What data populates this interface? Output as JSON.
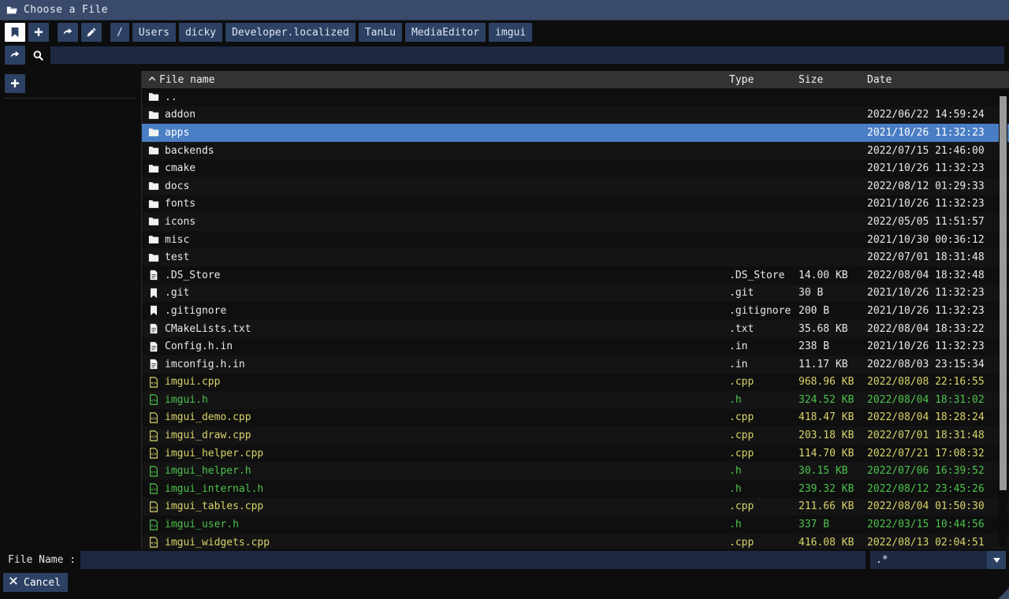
{
  "window": {
    "title": "Choose a File",
    "title_icon": "open-folder-icon"
  },
  "toolbar": {
    "bookmark_icon": "bookmark-icon",
    "add_icon": "plus-icon",
    "share_icon": "share-arrow-icon",
    "edit_icon": "pencil-icon",
    "root_label": "/",
    "breadcrumbs": [
      "Users",
      "dicky",
      "Developer.localized",
      "TanLu",
      "MediaEditor",
      "imgui"
    ]
  },
  "search": {
    "reset_icon": "share-arrow-icon",
    "search_icon": "magnifier-icon",
    "value": "",
    "placeholder": ""
  },
  "sidebar": {
    "add_icon": "plus-icon",
    "bookmarks": []
  },
  "table": {
    "columns": [
      "File name",
      "Type",
      "Size",
      "Date"
    ],
    "sort_indicator": "chevron-up-icon",
    "sort_column": "File name",
    "rows": [
      {
        "icon": "folder-icon",
        "name": "..",
        "type": "",
        "size": "",
        "date": "",
        "color": "#e9e9e9",
        "selected": false
      },
      {
        "icon": "folder-icon",
        "name": "addon",
        "type": "",
        "size": "",
        "date": "2022/06/22 14:59:24",
        "color": "#e9e9e9",
        "selected": false
      },
      {
        "icon": "folder-icon",
        "name": "apps",
        "type": "",
        "size": "",
        "date": "2021/10/26 11:32:23",
        "color": "#ffffff",
        "selected": true
      },
      {
        "icon": "folder-icon",
        "name": "backends",
        "type": "",
        "size": "",
        "date": "2022/07/15 21:46:00",
        "color": "#e9e9e9",
        "selected": false
      },
      {
        "icon": "folder-icon",
        "name": "cmake",
        "type": "",
        "size": "",
        "date": "2021/10/26 11:32:23",
        "color": "#e9e9e9",
        "selected": false
      },
      {
        "icon": "folder-icon",
        "name": "docs",
        "type": "",
        "size": "",
        "date": "2022/08/12 01:29:33",
        "color": "#e9e9e9",
        "selected": false
      },
      {
        "icon": "folder-icon",
        "name": "fonts",
        "type": "",
        "size": "",
        "date": "2021/10/26 11:32:23",
        "color": "#e9e9e9",
        "selected": false
      },
      {
        "icon": "folder-icon",
        "name": "icons",
        "type": "",
        "size": "",
        "date": "2022/05/05 11:51:57",
        "color": "#e9e9e9",
        "selected": false
      },
      {
        "icon": "folder-icon",
        "name": "misc",
        "type": "",
        "size": "",
        "date": "2021/10/30 00:36:12",
        "color": "#e9e9e9",
        "selected": false
      },
      {
        "icon": "folder-icon",
        "name": "test",
        "type": "",
        "size": "",
        "date": "2022/07/01 18:31:48",
        "color": "#e9e9e9",
        "selected": false
      },
      {
        "icon": "document-icon",
        "name": ".DS_Store",
        "type": ".DS_Store",
        "size": "14.00 KB",
        "date": "2022/08/04 18:32:48",
        "color": "#e9e9e9",
        "selected": false
      },
      {
        "icon": "bookmark-icon",
        "name": ".git",
        "type": ".git",
        "size": "30 B",
        "date": "2021/10/26 11:32:23",
        "color": "#e9e9e9",
        "selected": false
      },
      {
        "icon": "bookmark-icon",
        "name": ".gitignore",
        "type": ".gitignore",
        "size": "200 B",
        "date": "2021/10/26 11:32:23",
        "color": "#e9e9e9",
        "selected": false
      },
      {
        "icon": "document-icon",
        "name": "CMakeLists.txt",
        "type": ".txt",
        "size": "35.68 KB",
        "date": "2022/08/04 18:33:22",
        "color": "#e9e9e9",
        "selected": false
      },
      {
        "icon": "document-icon",
        "name": "Config.h.in",
        "type": ".in",
        "size": "238 B",
        "date": "2021/10/26 11:32:23",
        "color": "#e9e9e9",
        "selected": false
      },
      {
        "icon": "document-icon",
        "name": "imconfig.h.in",
        "type": ".in",
        "size": "11.17 KB",
        "date": "2022/08/03 23:15:34",
        "color": "#e9e9e9",
        "selected": false
      },
      {
        "icon": "code-file-icon",
        "name": "imgui.cpp",
        "type": ".cpp",
        "size": "968.96 KB",
        "date": "2022/08/08 22:16:55",
        "color": "#d9d36a",
        "selected": false
      },
      {
        "icon": "code-file-icon",
        "name": "imgui.h",
        "type": ".h",
        "size": "324.52 KB",
        "date": "2022/08/04 18:31:02",
        "color": "#4cc24c",
        "selected": false
      },
      {
        "icon": "code-file-icon",
        "name": "imgui_demo.cpp",
        "type": ".cpp",
        "size": "418.47 KB",
        "date": "2022/08/04 18:28:24",
        "color": "#d9d36a",
        "selected": false
      },
      {
        "icon": "code-file-icon",
        "name": "imgui_draw.cpp",
        "type": ".cpp",
        "size": "203.18 KB",
        "date": "2022/07/01 18:31:48",
        "color": "#d9d36a",
        "selected": false
      },
      {
        "icon": "code-file-icon",
        "name": "imgui_helper.cpp",
        "type": ".cpp",
        "size": "114.70 KB",
        "date": "2022/07/21 17:08:32",
        "color": "#d9d36a",
        "selected": false
      },
      {
        "icon": "code-file-icon",
        "name": "imgui_helper.h",
        "type": ".h",
        "size": "30.15 KB",
        "date": "2022/07/06 16:39:52",
        "color": "#4cc24c",
        "selected": false
      },
      {
        "icon": "code-file-icon",
        "name": "imgui_internal.h",
        "type": ".h",
        "size": "239.32 KB",
        "date": "2022/08/12 23:45:26",
        "color": "#4cc24c",
        "selected": false
      },
      {
        "icon": "code-file-icon",
        "name": "imgui_tables.cpp",
        "type": ".cpp",
        "size": "211.66 KB",
        "date": "2022/08/04 01:50:30",
        "color": "#d9d36a",
        "selected": false
      },
      {
        "icon": "code-file-icon",
        "name": "imgui_user.h",
        "type": ".h",
        "size": "337 B",
        "date": "2022/03/15 10:44:56",
        "color": "#4cc24c",
        "selected": false
      },
      {
        "icon": "code-file-icon",
        "name": "imgui_widgets.cpp",
        "type": ".cpp",
        "size": "416.08 KB",
        "date": "2022/08/13 02:04:51",
        "color": "#d9d36a",
        "selected": false
      }
    ]
  },
  "footer": {
    "filename_label": "File Name :",
    "filename_value": "",
    "filename_placeholder": "",
    "filter_value": ".*",
    "filter_caret_icon": "caret-down-icon",
    "cancel_label": "Cancel",
    "cancel_icon": "close-icon"
  },
  "colors": {
    "accent": "#2c4164",
    "selection": "#4a7ec4",
    "titlebar": "#3a4a6b",
    "cpp": "#d9d36a",
    "header": "#4cc24c"
  }
}
